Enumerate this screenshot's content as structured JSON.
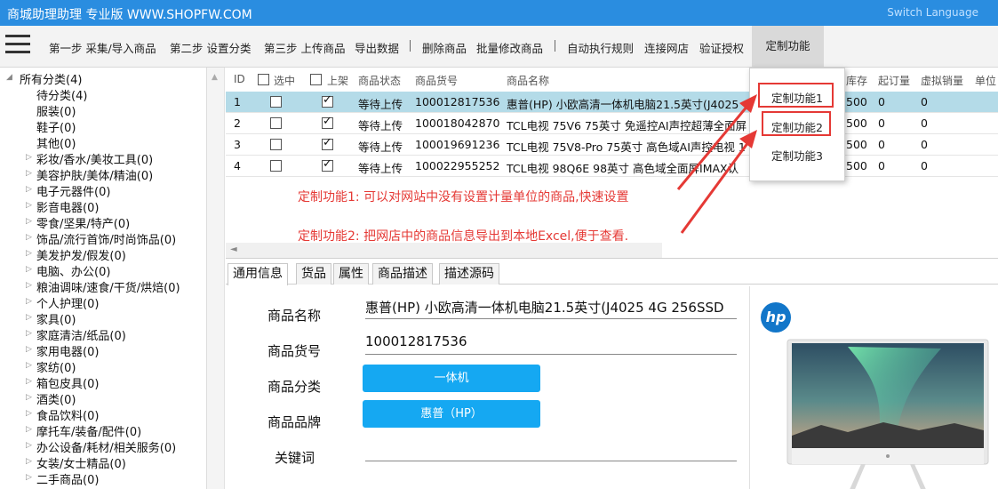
{
  "app": {
    "title": "商城助理助理 专业版 WWW.SHOPFW.COM",
    "switch_language": "Switch Language"
  },
  "menu": {
    "items": [
      "第一步 采集/导入商品",
      "第二步 设置分类",
      "第三步 上传商品",
      "导出数据",
      "删除商品",
      "批量修改商品",
      "自动执行规则",
      "连接网店",
      "验证授权",
      "定制功能"
    ],
    "separator": "|"
  },
  "tree": {
    "root": "所有分类(4)",
    "items": [
      {
        "label": "待分类(4)",
        "expandable": false
      },
      {
        "label": "服装(0)",
        "expandable": false
      },
      {
        "label": "鞋子(0)",
        "expandable": false
      },
      {
        "label": "其他(0)",
        "expandable": false
      },
      {
        "label": "彩妆/香水/美妆工具(0)",
        "expandable": true
      },
      {
        "label": "美容护肤/美体/精油(0)",
        "expandable": true
      },
      {
        "label": "电子元器件(0)",
        "expandable": true
      },
      {
        "label": "影音电器(0)",
        "expandable": true
      },
      {
        "label": "零食/坚果/特产(0)",
        "expandable": true
      },
      {
        "label": "饰品/流行首饰/时尚饰品(0)",
        "expandable": true
      },
      {
        "label": "美发护发/假发(0)",
        "expandable": true
      },
      {
        "label": "电脑、办公(0)",
        "expandable": true
      },
      {
        "label": "粮油调味/速食/干货/烘焙(0)",
        "expandable": true
      },
      {
        "label": "个人护理(0)",
        "expandable": true
      },
      {
        "label": "家具(0)",
        "expandable": true
      },
      {
        "label": "家庭清洁/纸品(0)",
        "expandable": true
      },
      {
        "label": "家用电器(0)",
        "expandable": true
      },
      {
        "label": "家纺(0)",
        "expandable": true
      },
      {
        "label": "箱包皮具(0)",
        "expandable": true
      },
      {
        "label": "酒类(0)",
        "expandable": true
      },
      {
        "label": "食品饮料(0)",
        "expandable": true
      },
      {
        "label": "摩托车/装备/配件(0)",
        "expandable": true
      },
      {
        "label": "办公设备/耗材/相关服务(0)",
        "expandable": true
      },
      {
        "label": "女装/女士精品(0)",
        "expandable": true
      },
      {
        "label": "二手商品(0)",
        "expandable": true
      }
    ]
  },
  "grid": {
    "columns": [
      "ID",
      "选中",
      "上架",
      "商品状态",
      "商品货号",
      "商品名称",
      "库存",
      "起订量",
      "虚拟销量",
      "单位"
    ],
    "rows": [
      {
        "id": "1",
        "selected": false,
        "listed": true,
        "status": "等待上传",
        "sku": "100012817536",
        "name": "惠普(HP) 小欧高清一体机电脑21.5英寸(J4025",
        "stock": "500",
        "moq": "0",
        "virtual_sales": "0",
        "unit": ""
      },
      {
        "id": "2",
        "selected": false,
        "listed": true,
        "status": "等待上传",
        "sku": "100018042870",
        "name": "TCL电视 75V6 75英寸 免遥控AI声控超薄全面屏",
        "stock": "500",
        "moq": "0",
        "virtual_sales": "0",
        "unit": ""
      },
      {
        "id": "3",
        "selected": false,
        "listed": true,
        "status": "等待上传",
        "sku": "100019691236",
        "name": "TCL电视 75V8-Pro 75英寸 高色域AI声控电视 1",
        "stock": "500",
        "moq": "0",
        "virtual_sales": "0",
        "unit": ""
      },
      {
        "id": "4",
        "selected": false,
        "listed": true,
        "status": "等待上传",
        "sku": "100022955252",
        "name": "TCL电视 98Q6E 98英寸 高色域全面屏IMAX认",
        "stock": "500",
        "moq": "0",
        "virtual_sales": "0",
        "unit": ""
      }
    ]
  },
  "dropdown": {
    "items": [
      "定制功能1",
      "定制功能2",
      "定制功能3"
    ]
  },
  "annotations": {
    "line1": "定制功能1: 可以对网站中没有设置计量单位的商品,快速设置",
    "line2": "定制功能2: 把网店中的商品信息导出到本地Excel,便于查看."
  },
  "tabs": [
    "通用信息",
    "货品",
    "属性",
    "商品描述",
    "描述源码"
  ],
  "form": {
    "name_label": "商品名称",
    "name_value": "惠普(HP) 小欧高清一体机电脑21.5英寸(J4025 4G 256SSD",
    "sku_label": "商品货号",
    "sku_value": "100012817536",
    "category_label": "商品分类",
    "category_value": "一体机",
    "brand_label": "商品品牌",
    "brand_value": "惠普（HP）",
    "keywords_label": "关键词",
    "keywords_value": ""
  },
  "image": {
    "logo_text": "hp"
  },
  "colors": {
    "titlebar": "#2a8de0",
    "selected_row": "#b4dbe8",
    "annotation_red": "#e53935",
    "button_blue": "#15a8f2"
  }
}
